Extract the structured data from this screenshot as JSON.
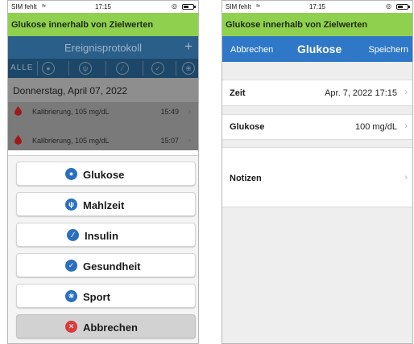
{
  "status": {
    "carrier": "SIM fehlt",
    "time": "17:15"
  },
  "banner": "Glukose innerhalb von Zielwerten",
  "log": {
    "title": "Ereignisprotokoll",
    "add_label": "+",
    "filter_all": "ALLE",
    "filters": [
      "glucose-icon",
      "meal-icon",
      "insulin-icon",
      "health-icon",
      "sport-icon"
    ],
    "date_header": "Donnerstag, April 07, 2022",
    "entries": [
      {
        "label": "Kalibrierung, 105 mg/dL",
        "time": "15:49"
      },
      {
        "label": "Kalibrierung, 105 mg/dL",
        "time": "15:07"
      }
    ]
  },
  "actions": {
    "glukose": "Glukose",
    "mahlzeit": "Mahlzeit",
    "insulin": "Insulin",
    "gesundheit": "Gesundheit",
    "sport": "Sport",
    "abbrechen": "Abbrechen"
  },
  "colors": {
    "banner": "#8fd14f",
    "navbar": "#2e78c7",
    "glucose_icon": "#2a6fbf",
    "cancel_icon": "#d93a3a",
    "calibration_drop": "#9e1a1a"
  },
  "form": {
    "cancel_label": "Abbrechen",
    "title": "Glukose",
    "save_label": "Speichern",
    "rows": {
      "zeit_label": "Zeit",
      "zeit_value": "Apr. 7, 2022 17:15",
      "glukose_label": "Glukose",
      "glukose_value": "100 mg/dL",
      "notizen_label": "Notizen"
    }
  }
}
